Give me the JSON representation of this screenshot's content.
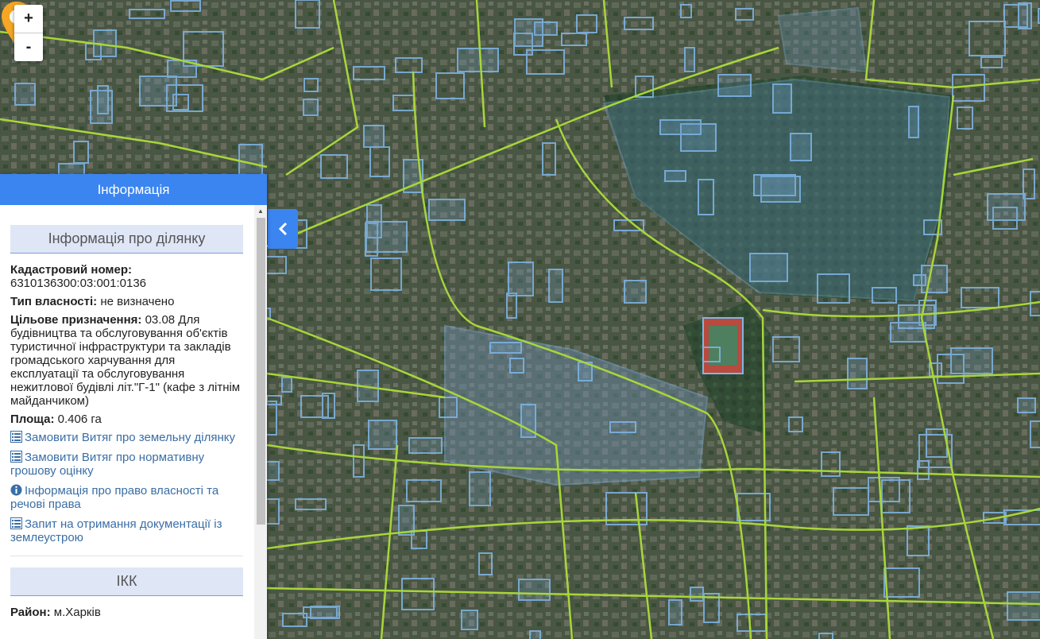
{
  "zoom": {
    "in_label": "+",
    "out_label": "-"
  },
  "panel": {
    "header": "Інформація",
    "parcel_section_title": "Інформація про ділянку",
    "cadastral_label": "Кадастровий номер:",
    "cadastral_value": "6310136300:03:001:0136",
    "ownership_label": "Тип власності:",
    "ownership_value": "не визначено",
    "purpose_label": "Цільове призначення:",
    "purpose_value": "03.08 Для будівництва та обслуговування об'єктів туристичної інфраструктури та закладів громадського харчування для експлуатації та обслуговування нежитлової будівлі літ.\"Г-1\" (кафе з літнім майданчиком)",
    "area_label": "Площа:",
    "area_value": "0.406 га",
    "links": [
      {
        "icon": "list-icon",
        "text": "Замовити Витяг про земельну ділянку"
      },
      {
        "icon": "list-icon",
        "text": "Замовити Витяг про нормативну грошову оцінку"
      },
      {
        "icon": "info-icon",
        "text": "Інформація про право власності та речові права"
      },
      {
        "icon": "list-icon",
        "text": "Запит на отримання документації із землеустрою"
      }
    ],
    "ikk_section_title": "ІКК",
    "district_label": "Район:",
    "district_value": "м.Харків"
  },
  "colors": {
    "accent": "#3b85f0",
    "section_bg": "#dfe6f6",
    "road_lines": "#a8d63a",
    "parcel_outline": "#7fb6e8",
    "marker": "#f5a623"
  }
}
